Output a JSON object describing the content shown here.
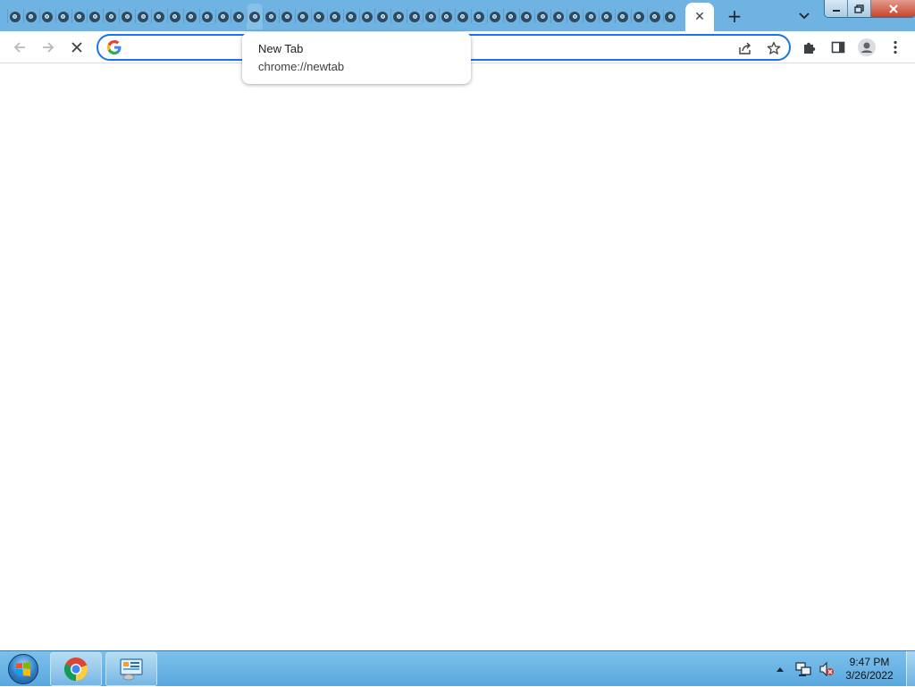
{
  "browser": {
    "tab_strip": {
      "mini_tab_count": 42,
      "hovered_mini_tab_index": 15,
      "tab_icon": "chrome-favicon-icon",
      "active_tab_close_icon": "close-icon",
      "new_tab_icon": "plus-icon",
      "tab_search_icon": "chevron-down-icon"
    },
    "window_controls": {
      "minimize_icon": "minimize-icon",
      "restore_icon": "restore-icon",
      "close_icon": "close-icon"
    },
    "toolbar": {
      "back_icon": "back-arrow-icon",
      "forward_icon": "forward-arrow-icon",
      "stop_icon": "stop-loading-icon",
      "omnibox": {
        "value": "",
        "placeholder": "",
        "search_engine_icon": "google-g-icon",
        "share_icon": "share-icon",
        "bookmark_icon": "star-icon"
      },
      "extensions_icon": "puzzle-piece-icon",
      "side_panel_icon": "side-panel-icon",
      "profile_icon": "profile-avatar-icon",
      "menu_icon": "more-vertical-icon"
    },
    "hover_card": {
      "title": "New Tab",
      "url": "chrome://newtab"
    },
    "colors": {
      "tab_strip": "#6fb3e3",
      "omnibox_focus": "#1a73e8",
      "toolbar_bg": "#ffffff"
    }
  },
  "taskbar": {
    "start_icon": "windows-start-orb-icon",
    "pinned": [
      {
        "name": "chrome",
        "icon": "chrome-icon",
        "active": true
      },
      {
        "name": "control-panel",
        "icon": "control-panel-icon",
        "active": false
      }
    ],
    "tray": {
      "show_hidden_icon": "caret-up-icon",
      "network_icon": "network-icon",
      "volume_icon": "volume-muted-icon",
      "time": "9:47 PM",
      "date": "3/26/2022"
    },
    "colors": {
      "taskbar": "#5aa8df"
    }
  }
}
